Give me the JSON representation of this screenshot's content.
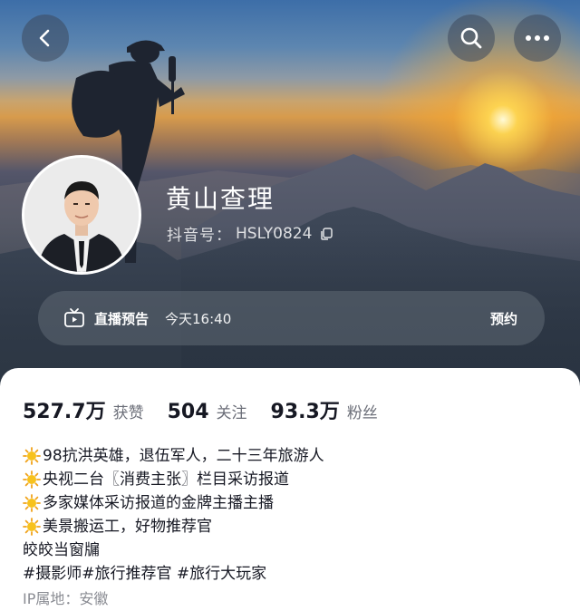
{
  "header": {
    "back_icon": "chevron-left-icon",
    "search_icon": "search-icon",
    "more_icon": "more-horizontal-icon"
  },
  "profile": {
    "name": "黄山查理",
    "douyin_id_label": "抖音号：",
    "douyin_id": "HSLY0824",
    "copy_icon": "copy-icon"
  },
  "live_preview": {
    "icon": "tv-icon",
    "title": "直播预告",
    "time": "今天16:40",
    "reserve_label": "预约"
  },
  "stats": [
    {
      "value": "527.7万",
      "label": "获赞"
    },
    {
      "value": "504",
      "label": "关注"
    },
    {
      "value": "93.3万",
      "label": "粉丝"
    }
  ],
  "bio": {
    "lines": [
      "98抗洪英雄，退伍军人，二十三年旅游人",
      "央视二台〖消费主张〗栏目采访报道",
      "多家媒体采访报道的金牌主播主播",
      "美景搬运工，好物推荐官",
      "皎皎当窗牖",
      "#摄影师#旅行推荐官 #旅行大玩家"
    ],
    "emoji_icon": "sun-emoji-icon",
    "ip_label": "IP属地：",
    "ip_value": "安徽"
  },
  "colors": {
    "primary_text": "#161823",
    "secondary_text": "#6b6e78",
    "ip_text": "#8a8c93",
    "live_bar_bg": "#5a6470"
  }
}
